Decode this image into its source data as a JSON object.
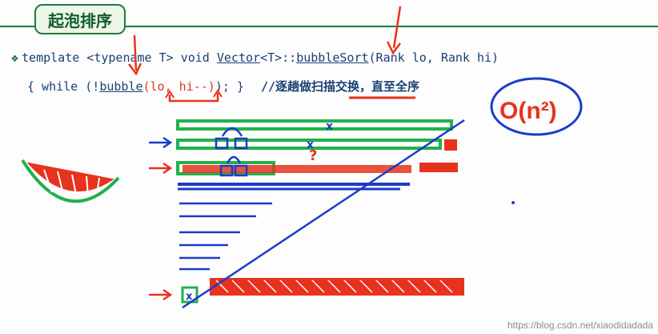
{
  "title": "起泡排序",
  "code": {
    "bullet": "❖",
    "line1": {
      "prefix": "template <typename T> void ",
      "vector": "Vector",
      "mid": "<T>::",
      "func": "bubbleSort",
      "suffix": "(Rank lo, Rank hi)"
    },
    "line2": {
      "prefix": "{ while (!",
      "bubble": "bubble",
      "args": "(lo, hi--)",
      "end": "); }",
      "comment": "//逐趟做扫描交换，直至全序"
    }
  },
  "annotation": {
    "complexity": "O(n²)",
    "question_mark": "?"
  },
  "watermark": "https://blog.csdn.net/xiaodidadada",
  "colors": {
    "green": "#22b14c",
    "red": "#e8321e",
    "blue": "#1a3cc8",
    "code": "#1a3f73"
  }
}
